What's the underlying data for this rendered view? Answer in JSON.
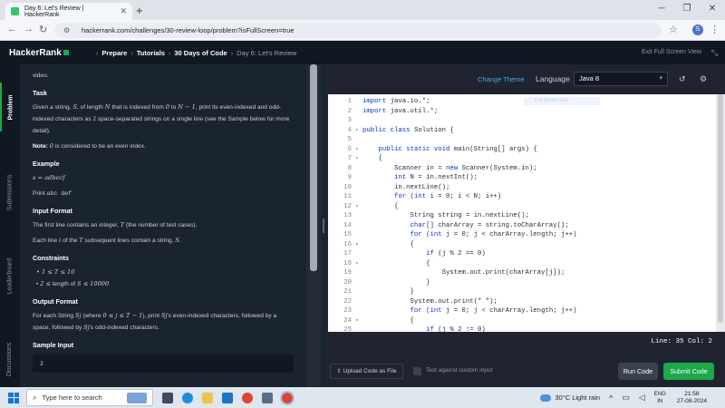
{
  "browser": {
    "tab_title": "Day 6: Let's Review | HackerRank",
    "tab_close": "✕",
    "new_tab": "+",
    "url": "hackerrank.com/challenges/30-review-loop/problem?isFullScreen=true",
    "profile_initial": "S"
  },
  "header": {
    "logo": "HackerRank",
    "crumbs": [
      "Prepare",
      "Tutorials",
      "30 Days of Code"
    ],
    "current": "Day 6: Let's Review",
    "exit_full_screen": "Exit Full Screen View"
  },
  "sidetabs": {
    "problem": "Problem",
    "submissions": "Submissions",
    "leaderboard": "Leaderboard",
    "discussions": "Discussions"
  },
  "problem": {
    "top_fragment": "video.",
    "task_heading": "Task",
    "task_text_a": "Given a string,",
    "task_var_s": "S",
    "task_text_b": ", of length",
    "task_var_n": "N",
    "task_text_c": "that is indexed from",
    "task_zero": "0",
    "task_text_d": "to",
    "task_nminus": "N − 1",
    "task_text_e": ", print its even-indexed and odd-indexed characters as 2 space-separated strings on a single line (see the Sample below for more detail).",
    "note_label": "Note:",
    "note_zero": "0",
    "note_text": "is considered to be an even index.",
    "example_heading": "Example",
    "example_assign": "s = adbecf",
    "example_print_label": "Print",
    "example_print_value": "abc def",
    "input_heading": "Input Format",
    "input_line1_a": "The first line contains an integer,",
    "input_var_t": "T",
    "input_line1_b": "(the number of test cases).",
    "input_line2_a": "Each line",
    "input_var_i": "i",
    "input_line2_b": "of the",
    "input_line2_c": "subsequent lines contain a string,",
    "input_line2_end": ".",
    "constraints_heading": "Constraints",
    "constraint1": "1 ≤ T ≤ 10",
    "constraint2_a": "2 ≤",
    "constraint2_b": "length of",
    "constraint2_c": "S ≤ 10000",
    "output_heading": "Output Format",
    "output_line1_a": "For each String",
    "output_var_sj": "Sj",
    "output_where": "(where",
    "output_range": "0 ≤ j ≤ T − 1",
    "output_line1_b": "), print",
    "output_sj_tail": "'s even-indexed characters, followed",
    "output_line2_a": "by a space, followed by",
    "output_line2_b": "'s odd-indexed characters.",
    "sample_heading": "Sample Input",
    "sample_value": "2"
  },
  "editor": {
    "change_theme": "Change Theme",
    "language_label": "Language",
    "language_value": "Java 8",
    "hint_overlay": "Full Screen View",
    "lines": [
      {
        "n": "1",
        "fold": "",
        "text": "import java.io.*;"
      },
      {
        "n": "2",
        "fold": "",
        "text": "import java.util.*;"
      },
      {
        "n": "3",
        "fold": "",
        "text": ""
      },
      {
        "n": "4",
        "fold": "▾",
        "text": "public class Solution {"
      },
      {
        "n": "5",
        "fold": "",
        "text": ""
      },
      {
        "n": "6",
        "fold": "▾",
        "text": "    public static void main(String[] args) {"
      },
      {
        "n": "7",
        "fold": "▾",
        "text": "    {"
      },
      {
        "n": "8",
        "fold": "",
        "text": "        Scanner in = new Scanner(System.in);"
      },
      {
        "n": "9",
        "fold": "",
        "text": "        int N = in.nextInt();"
      },
      {
        "n": "10",
        "fold": "",
        "text": "        in.nextLine();"
      },
      {
        "n": "11",
        "fold": "",
        "text": "        for (int i = 0; i < N; i++)"
      },
      {
        "n": "12",
        "fold": "▾",
        "text": "        {"
      },
      {
        "n": "13",
        "fold": "",
        "text": "            String string = in.nextLine();"
      },
      {
        "n": "14",
        "fold": "",
        "text": "            char[] charArray = string.toCharArray();"
      },
      {
        "n": "15",
        "fold": "",
        "text": "            for (int j = 0; j < charArray.length; j++)"
      },
      {
        "n": "16",
        "fold": "▾",
        "text": "            {"
      },
      {
        "n": "17",
        "fold": "",
        "text": "                if (j % 2 == 0)"
      },
      {
        "n": "18",
        "fold": "▾",
        "text": "                {"
      },
      {
        "n": "19",
        "fold": "",
        "text": "                    System.out.print(charArray[j]);"
      },
      {
        "n": "20",
        "fold": "",
        "text": "                }"
      },
      {
        "n": "21",
        "fold": "",
        "text": "            }"
      },
      {
        "n": "22",
        "fold": "",
        "text": "            System.out.print(\" \");"
      },
      {
        "n": "23",
        "fold": "",
        "text": "            for (int j = 0; j < charArray.length; j++)"
      },
      {
        "n": "24",
        "fold": "▾",
        "text": "            {"
      },
      {
        "n": "25",
        "fold": "",
        "text": "                if (j % 2 != 0)"
      }
    ],
    "status": "Line: 35 Col: 2",
    "upload_label": "Upload Code as File",
    "custom_input_label": "Test against custom input",
    "run_label": "Run Code",
    "submit_label": "Submit Code"
  },
  "taskbar": {
    "search_placeholder": "Type here to search",
    "weather": "30°C  Light rain",
    "lang_line1": "ENG",
    "lang_line2": "IN",
    "time": "21:58",
    "date": "27-08-2024"
  },
  "colors": {
    "accent_green": "#1ba94c",
    "link_blue": "#43a9e8",
    "header_bg": "#101822"
  }
}
